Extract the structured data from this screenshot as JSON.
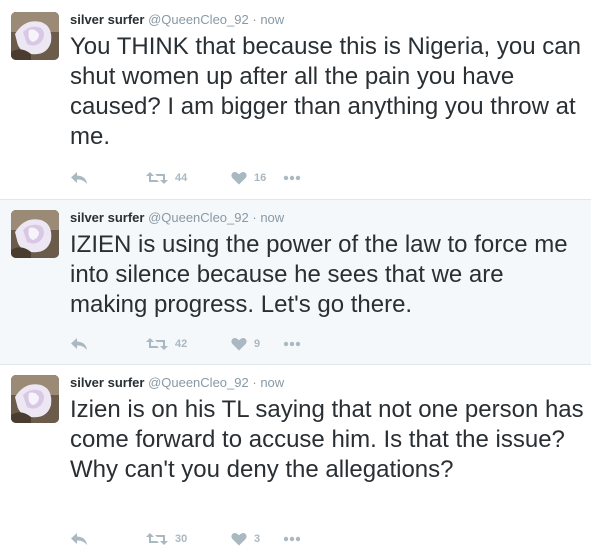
{
  "colors": {
    "name": "#292f33",
    "meta": "#8899a6",
    "icon": "#aab8c2",
    "alt_bg": "#f5f8fa",
    "border": "#e1e8ed"
  },
  "tweets": [
    {
      "fullname": "silver surfer",
      "username": "@QueenCleo_92",
      "separator": "·",
      "time": "now",
      "text": "You THINK that because this is Nigeria, you can shut women up after all the pain you have caused? I am bigger than anything you throw at me.",
      "retweets": "44",
      "likes": "16",
      "icons": [
        "reply-icon",
        "retweet-icon",
        "like-icon",
        "more-icon"
      ]
    },
    {
      "fullname": "silver surfer",
      "username": "@QueenCleo_92",
      "separator": "·",
      "time": "now",
      "text": "IZIEN is using the power of the law to force me into silence because he sees that we are making progress. Let's go there.",
      "retweets": "42",
      "likes": "9",
      "icons": [
        "reply-icon",
        "retweet-icon",
        "like-icon",
        "more-icon"
      ]
    },
    {
      "fullname": "silver surfer",
      "username": "@QueenCleo_92",
      "separator": "·",
      "time": "now",
      "text": "Izien is on his TL saying that not one person has come forward to accuse him. Is that the issue? Why can't you deny the allegations?",
      "retweets": "30",
      "likes": "3",
      "icons": [
        "reply-icon",
        "retweet-icon",
        "like-icon",
        "more-icon"
      ]
    }
  ]
}
